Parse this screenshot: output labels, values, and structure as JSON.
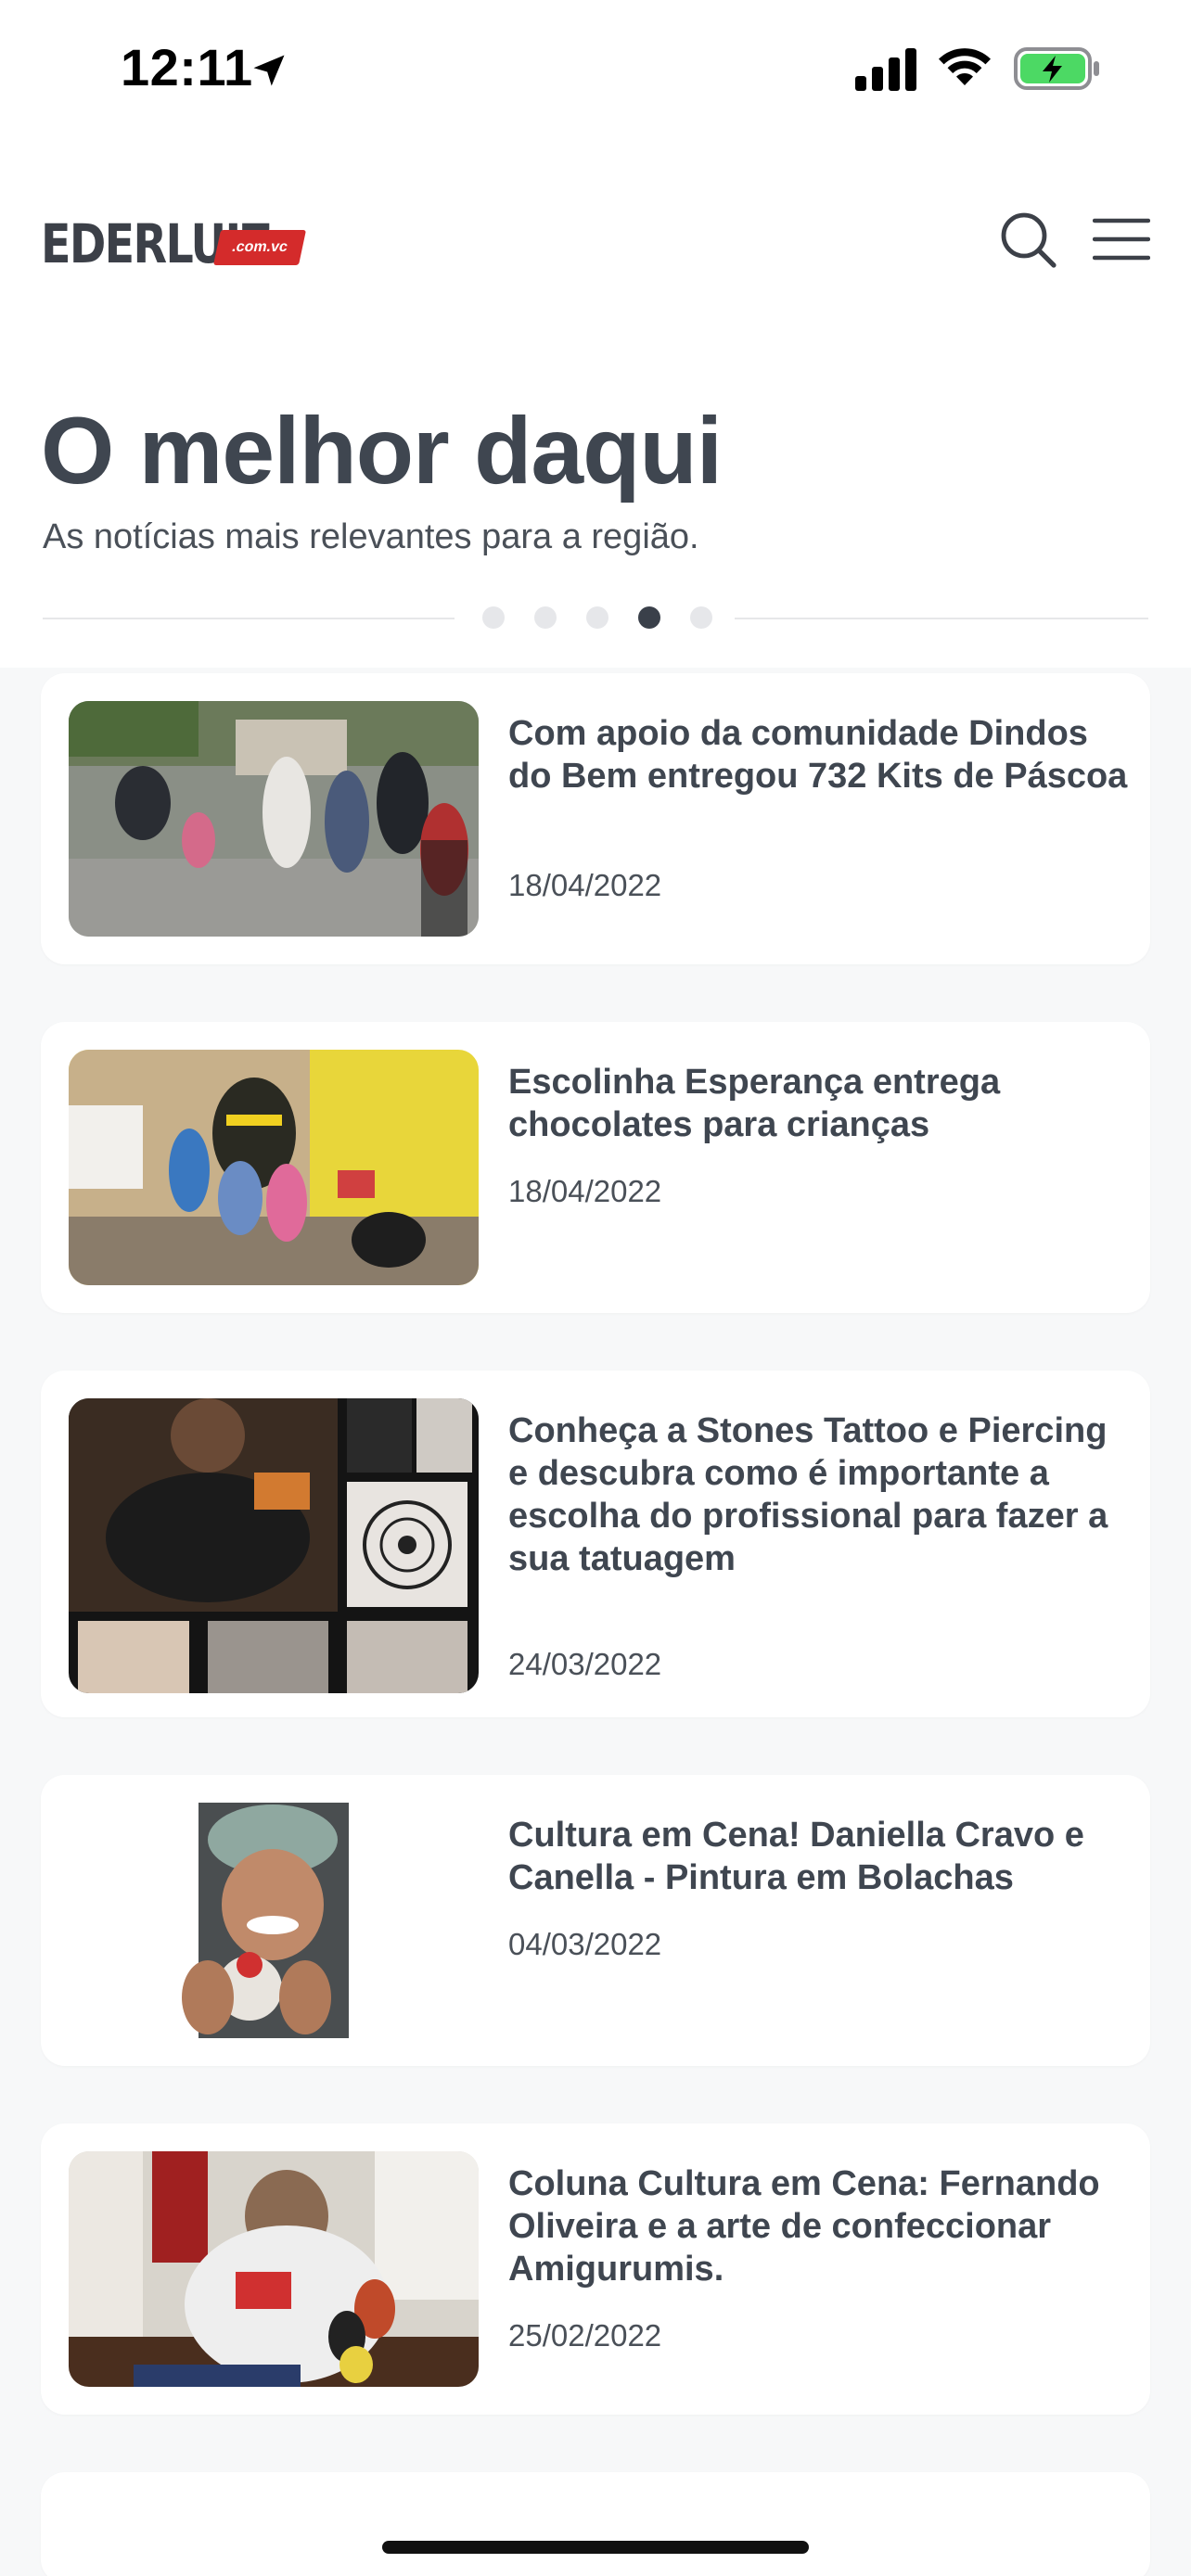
{
  "status_bar": {
    "time": "12:11"
  },
  "header": {
    "logo_text": "EDERLUIZ",
    "logo_badge": ".com.vc"
  },
  "hero": {
    "title": "O melhor daqui",
    "subtitle": "As notícias mais relevantes para a região.",
    "carousel": {
      "total": 5,
      "active_index": 3
    }
  },
  "articles": [
    {
      "title": "Com apoio da comunidade Dindos do Bem entregou 732 Kits de Páscoa",
      "date": "18/04/2022"
    },
    {
      "title": "Escolinha Esperança entrega chocolates para crianças",
      "date": "18/04/2022"
    },
    {
      "title": "Conheça a Stones Tattoo e Piercing e descubra como é importante a escolha do profissional para fazer a sua tatuagem",
      "date": "24/03/2022"
    },
    {
      "title": "Cultura em Cena! Daniella Cravo e Canella - Pintura em Bolachas",
      "date": "04/03/2022"
    },
    {
      "title": "Coluna Cultura em Cena: Fernando Oliveira e a arte de confeccionar Amigurumis.",
      "date": "25/02/2022"
    }
  ],
  "icons": {
    "location": "location-arrow-icon",
    "signal": "cellular-signal-icon",
    "wifi": "wifi-icon",
    "battery": "battery-charging-icon",
    "search": "search-icon",
    "menu": "hamburger-menu-icon"
  },
  "colors": {
    "text": "#3f4650",
    "accent_badge": "#d42b2b",
    "battery_fill": "#4cd964",
    "dot_active": "#3a404a",
    "dot_inactive": "#e6e7ea"
  }
}
